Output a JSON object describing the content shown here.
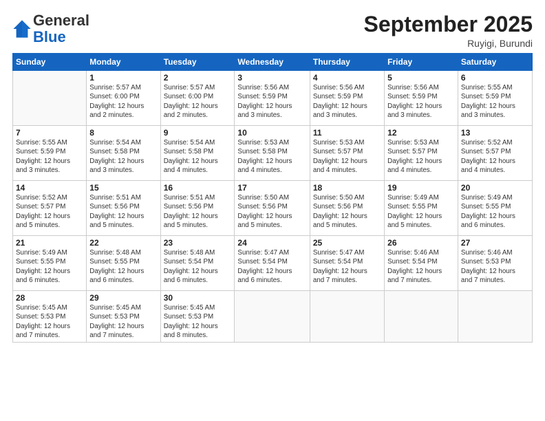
{
  "logo": {
    "line1": "General",
    "line2": "Blue"
  },
  "title": "September 2025",
  "location": "Ruyigi, Burundi",
  "headers": [
    "Sunday",
    "Monday",
    "Tuesday",
    "Wednesday",
    "Thursday",
    "Friday",
    "Saturday"
  ],
  "weeks": [
    [
      {
        "num": "",
        "info": ""
      },
      {
        "num": "1",
        "info": "Sunrise: 5:57 AM\nSunset: 6:00 PM\nDaylight: 12 hours\nand 2 minutes."
      },
      {
        "num": "2",
        "info": "Sunrise: 5:57 AM\nSunset: 6:00 PM\nDaylight: 12 hours\nand 2 minutes."
      },
      {
        "num": "3",
        "info": "Sunrise: 5:56 AM\nSunset: 5:59 PM\nDaylight: 12 hours\nand 3 minutes."
      },
      {
        "num": "4",
        "info": "Sunrise: 5:56 AM\nSunset: 5:59 PM\nDaylight: 12 hours\nand 3 minutes."
      },
      {
        "num": "5",
        "info": "Sunrise: 5:56 AM\nSunset: 5:59 PM\nDaylight: 12 hours\nand 3 minutes."
      },
      {
        "num": "6",
        "info": "Sunrise: 5:55 AM\nSunset: 5:59 PM\nDaylight: 12 hours\nand 3 minutes."
      }
    ],
    [
      {
        "num": "7",
        "info": "Sunrise: 5:55 AM\nSunset: 5:59 PM\nDaylight: 12 hours\nand 3 minutes."
      },
      {
        "num": "8",
        "info": "Sunrise: 5:54 AM\nSunset: 5:58 PM\nDaylight: 12 hours\nand 3 minutes."
      },
      {
        "num": "9",
        "info": "Sunrise: 5:54 AM\nSunset: 5:58 PM\nDaylight: 12 hours\nand 4 minutes."
      },
      {
        "num": "10",
        "info": "Sunrise: 5:53 AM\nSunset: 5:58 PM\nDaylight: 12 hours\nand 4 minutes."
      },
      {
        "num": "11",
        "info": "Sunrise: 5:53 AM\nSunset: 5:57 PM\nDaylight: 12 hours\nand 4 minutes."
      },
      {
        "num": "12",
        "info": "Sunrise: 5:53 AM\nSunset: 5:57 PM\nDaylight: 12 hours\nand 4 minutes."
      },
      {
        "num": "13",
        "info": "Sunrise: 5:52 AM\nSunset: 5:57 PM\nDaylight: 12 hours\nand 4 minutes."
      }
    ],
    [
      {
        "num": "14",
        "info": "Sunrise: 5:52 AM\nSunset: 5:57 PM\nDaylight: 12 hours\nand 5 minutes."
      },
      {
        "num": "15",
        "info": "Sunrise: 5:51 AM\nSunset: 5:56 PM\nDaylight: 12 hours\nand 5 minutes."
      },
      {
        "num": "16",
        "info": "Sunrise: 5:51 AM\nSunset: 5:56 PM\nDaylight: 12 hours\nand 5 minutes."
      },
      {
        "num": "17",
        "info": "Sunrise: 5:50 AM\nSunset: 5:56 PM\nDaylight: 12 hours\nand 5 minutes."
      },
      {
        "num": "18",
        "info": "Sunrise: 5:50 AM\nSunset: 5:56 PM\nDaylight: 12 hours\nand 5 minutes."
      },
      {
        "num": "19",
        "info": "Sunrise: 5:49 AM\nSunset: 5:55 PM\nDaylight: 12 hours\nand 5 minutes."
      },
      {
        "num": "20",
        "info": "Sunrise: 5:49 AM\nSunset: 5:55 PM\nDaylight: 12 hours\nand 6 minutes."
      }
    ],
    [
      {
        "num": "21",
        "info": "Sunrise: 5:49 AM\nSunset: 5:55 PM\nDaylight: 12 hours\nand 6 minutes."
      },
      {
        "num": "22",
        "info": "Sunrise: 5:48 AM\nSunset: 5:55 PM\nDaylight: 12 hours\nand 6 minutes."
      },
      {
        "num": "23",
        "info": "Sunrise: 5:48 AM\nSunset: 5:54 PM\nDaylight: 12 hours\nand 6 minutes."
      },
      {
        "num": "24",
        "info": "Sunrise: 5:47 AM\nSunset: 5:54 PM\nDaylight: 12 hours\nand 6 minutes."
      },
      {
        "num": "25",
        "info": "Sunrise: 5:47 AM\nSunset: 5:54 PM\nDaylight: 12 hours\nand 7 minutes."
      },
      {
        "num": "26",
        "info": "Sunrise: 5:46 AM\nSunset: 5:54 PM\nDaylight: 12 hours\nand 7 minutes."
      },
      {
        "num": "27",
        "info": "Sunrise: 5:46 AM\nSunset: 5:53 PM\nDaylight: 12 hours\nand 7 minutes."
      }
    ],
    [
      {
        "num": "28",
        "info": "Sunrise: 5:45 AM\nSunset: 5:53 PM\nDaylight: 12 hours\nand 7 minutes."
      },
      {
        "num": "29",
        "info": "Sunrise: 5:45 AM\nSunset: 5:53 PM\nDaylight: 12 hours\nand 7 minutes."
      },
      {
        "num": "30",
        "info": "Sunrise: 5:45 AM\nSunset: 5:53 PM\nDaylight: 12 hours\nand 8 minutes."
      },
      {
        "num": "",
        "info": ""
      },
      {
        "num": "",
        "info": ""
      },
      {
        "num": "",
        "info": ""
      },
      {
        "num": "",
        "info": ""
      }
    ]
  ]
}
